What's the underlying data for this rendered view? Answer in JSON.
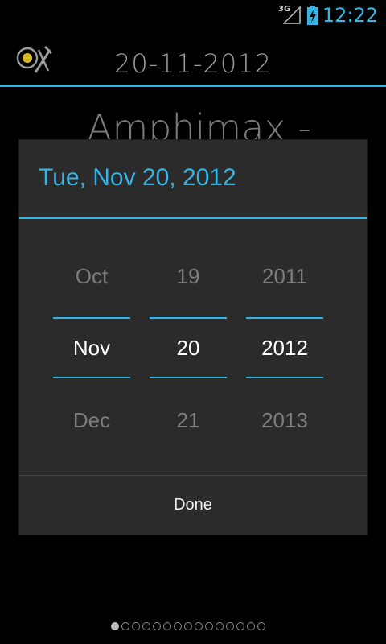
{
  "status_bar": {
    "network": "3G",
    "time": "12:22"
  },
  "action_bar": {
    "app_icon": "cooking-utensils-icon",
    "date": "20-11-2012"
  },
  "background": {
    "heading": "Amphimax -"
  },
  "date_picker": {
    "title": "Tue, Nov 20, 2012",
    "month": {
      "prev": "Oct",
      "current": "Nov",
      "next": "Dec"
    },
    "day": {
      "prev": "19",
      "current": "20",
      "next": "21"
    },
    "year": {
      "prev": "2011",
      "current": "2012",
      "next": "2013"
    },
    "done_label": "Done"
  },
  "pager": {
    "total_pages": 15,
    "current_page": 1
  },
  "colors": {
    "accent": "#33b5e5",
    "dialog_bg": "#2b2b2b"
  }
}
